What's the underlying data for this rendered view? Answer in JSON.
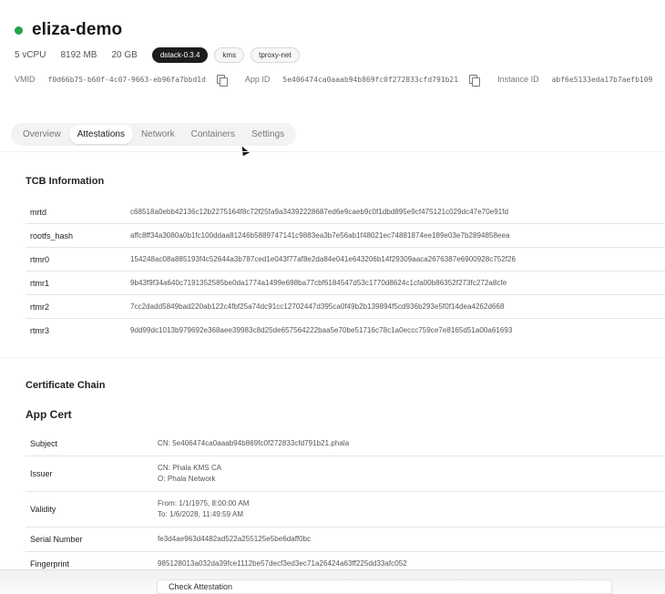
{
  "app": {
    "name": "eliza-demo",
    "status_color": "#22a447"
  },
  "specs": {
    "cpu": "5 vCPU",
    "memory": "8192 MB",
    "disk": "20 GB"
  },
  "badges": [
    "dstack-0.3.4",
    "kms",
    "tproxy-net"
  ],
  "ids": {
    "vmid_label": "VMID",
    "vmid_value": "f0d66b75-b60f-4c07-9663-eb96fa7bbd1d",
    "appid_label": "App ID",
    "appid_value": "5e406474ca0aaab94b869fc0f272833cfd791b21",
    "instance_label": "Instance ID",
    "instance_value": "abf6e5133eda17b7aefb109"
  },
  "tabs": [
    {
      "label": "Overview",
      "active": false
    },
    {
      "label": "Attestations",
      "active": true
    },
    {
      "label": "Network",
      "active": false
    },
    {
      "label": "Containers",
      "active": false
    },
    {
      "label": "Settings",
      "active": false
    }
  ],
  "tcb": {
    "title": "TCB Information",
    "rows": [
      {
        "key": "mrtd",
        "value": "c68518a0ebb42136c12b2275164f8c72f25fa9a34392228687ed6e9caeb9c0f1dbd895e9cf475121c029dc47e70e91fd"
      },
      {
        "key": "rootfs_hash",
        "value": "affc8ff34a3080a0b1fc100ddaa81246b5889747141c9883ea3b7e56ab1f48021ec74881874ee189e03e7b2894858eea"
      },
      {
        "key": "rtmr0",
        "value": "154248ac08a885193f4c52644a3b787ced1e043f77af8e2da84e041e643206b14f29309aaca2676387e6900928c752f26"
      },
      {
        "key": "rtmr1",
        "value": "9b43f9f34a640c7191352585be0da1774a1499e698ba77cbf6184547d53c1770d8624c1cfa00b86352f273fc272a8cfe"
      },
      {
        "key": "rtmr2",
        "value": "7cc2dadd5849bad220ab122c4fbf25a74dc91cc12702447d395ca0f49b2b139894f5cd936b293e5f0f14dea4262d668"
      },
      {
        "key": "rtmr3",
        "value": "9dd99dc1013b979692e368aee39983c8d25de657564222baa5e70be51716c78c1a0eccc759ce7e8165d51a00a61693"
      }
    ]
  },
  "cert_chain": {
    "title": "Certificate Chain",
    "app_cert_title": "App Cert",
    "rows": [
      {
        "key": "Subject",
        "lines": [
          "CN: 5e406474ca0aaab94b869fc0f272833cfd791b21.phala"
        ]
      },
      {
        "key": "Issuer",
        "lines": [
          "CN: Phala KMS CA",
          "O: Phala Network"
        ]
      },
      {
        "key": "Validity",
        "lines": [
          "From: 1/1/1975, 8:00:00 AM",
          "To: 1/6/2028, 11:49:59 AM"
        ]
      },
      {
        "key": "Serial Number",
        "lines": [
          "fe3d4ae963d4482ad522a255125e5be6daff0bc"
        ]
      },
      {
        "key": "Fingerprint",
        "lines": [
          "985128013a032da39fce1112be57decf3ed3ec71a26424a63ff225dd33afc052"
        ]
      }
    ]
  },
  "check_attestation_label": "Check Attestation"
}
